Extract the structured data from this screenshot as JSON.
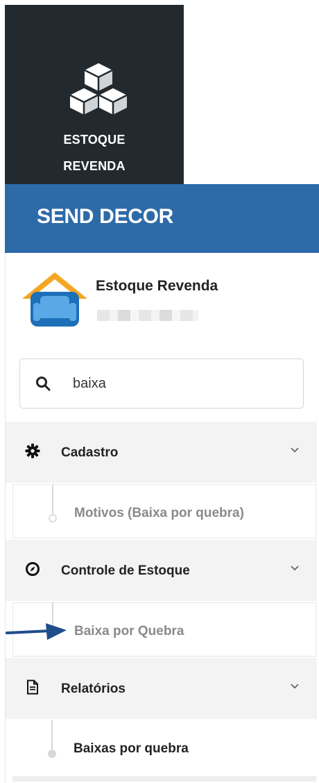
{
  "module_tile": {
    "icon": "cubes-icon",
    "label_line1": "ESTOQUE",
    "label_line2": "REVENDA",
    "bg_color": "#232a2f"
  },
  "brand": {
    "title": "SEND DECOR",
    "bg_color": "#2d6aa8"
  },
  "profile": {
    "avatar_icon": "house-armchair-logo",
    "name": "Estoque Revenda"
  },
  "search": {
    "icon": "search-icon",
    "value": "baixa"
  },
  "menu": {
    "sections": [
      {
        "icon": "gear-icon",
        "label": "Cadastro",
        "items": [
          {
            "label": "Motivos (Baixa por quebra)"
          }
        ]
      },
      {
        "icon": "compass-icon",
        "label": "Controle de Estoque",
        "items": [
          {
            "label": "Baixa por Quebra"
          }
        ]
      },
      {
        "icon": "document-icon",
        "label": "Relatórios",
        "items": [
          {
            "label": "Baixas por quebra"
          }
        ]
      }
    ]
  },
  "annotation": {
    "icon": "arrow-right-icon",
    "color": "#1f4e8a"
  }
}
